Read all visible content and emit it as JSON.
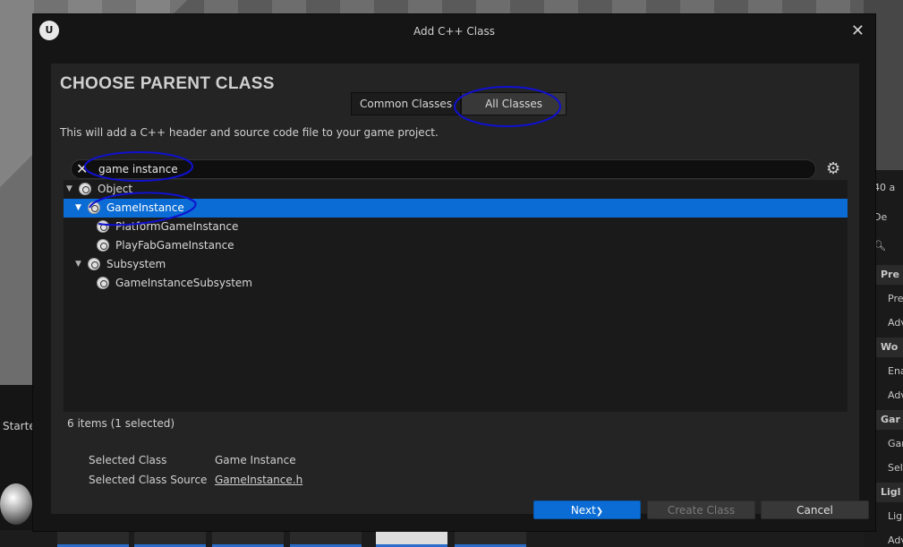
{
  "dialog": {
    "title": "Add C++ Class",
    "heading": "CHOOSE PARENT CLASS",
    "tabs": [
      "Common Classes",
      "All Classes"
    ],
    "active_tab": "All Classes",
    "description": "This will add a C++ header and source code file to your game project."
  },
  "search": {
    "value": "game instance",
    "clear_icon": "close-icon",
    "options_icon": "gear-icon"
  },
  "tree": {
    "rows": [
      {
        "label": "Object",
        "expanded": true,
        "selected": false
      },
      {
        "label": "GameInstance",
        "expanded": true,
        "selected": true
      },
      {
        "label": "PlatformGameInstance",
        "selected": false
      },
      {
        "label": "PlayFabGameInstance",
        "selected": false
      },
      {
        "label": "Subsystem",
        "expanded": true,
        "selected": false
      },
      {
        "label": "GameInstanceSubsystem",
        "selected": false
      }
    ]
  },
  "status": {
    "count": "6 items (1 selected)"
  },
  "selection": {
    "class_key": "Selected Class",
    "class_value": "Game Instance",
    "source_key": "Selected Class Source",
    "source_value": "GameInstance.h"
  },
  "buttons": {
    "next": "Next",
    "create": "Create Class",
    "cancel": "Cancel"
  },
  "background": {
    "right_panel": [
      "40 a",
      "De",
      "Pre",
      "Pre",
      "Adv",
      "Wo",
      "Ena",
      "Adv",
      "Gar",
      "Gar",
      "Sel",
      "Ligl",
      "Ligl",
      "Adv"
    ],
    "started": "Starte"
  },
  "colors": {
    "accent": "#0a6cd4",
    "annotation": "#1010d0"
  }
}
